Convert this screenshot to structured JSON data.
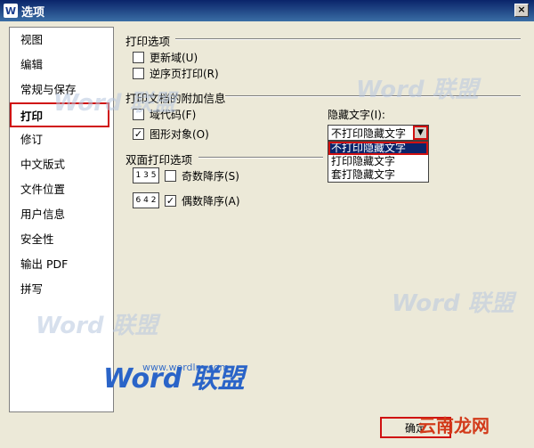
{
  "window": {
    "title": "选项",
    "close_label": "×"
  },
  "sidebar": {
    "items": [
      {
        "label": "视图"
      },
      {
        "label": "编辑"
      },
      {
        "label": "常规与保存"
      },
      {
        "label": "打印"
      },
      {
        "label": "修订"
      },
      {
        "label": "中文版式"
      },
      {
        "label": "文件位置"
      },
      {
        "label": "用户信息"
      },
      {
        "label": "安全性"
      },
      {
        "label": "输出 PDF"
      },
      {
        "label": "拼写"
      }
    ],
    "active": "打印"
  },
  "print_options": {
    "title": "打印选项",
    "update_fields": "更新域(U)",
    "reverse_order": "逆序页打印(R)"
  },
  "attach_info": {
    "title": "打印文档的附加信息",
    "field_codes": "域代码(F)",
    "drawing_objects": "图形对象(O)",
    "hidden_text_label": "隐藏文字(I):",
    "hidden_text_value": "不打印隐藏文字",
    "hidden_text_options": [
      "不打印隐藏文字",
      "打印隐藏文字",
      "套打隐藏文字"
    ]
  },
  "duplex": {
    "title": "双面打印选项",
    "odd_label": "奇数降序(S)",
    "even_label": "偶数降序(A)",
    "odd_icon": "1 3 5",
    "even_icon": "6 4 2"
  },
  "footer": {
    "ok_label": "确定"
  },
  "watermarks": {
    "brand_text": "Word 联盟",
    "brand_url": "www.wordlm.com",
    "site_text": "云南龙网"
  }
}
